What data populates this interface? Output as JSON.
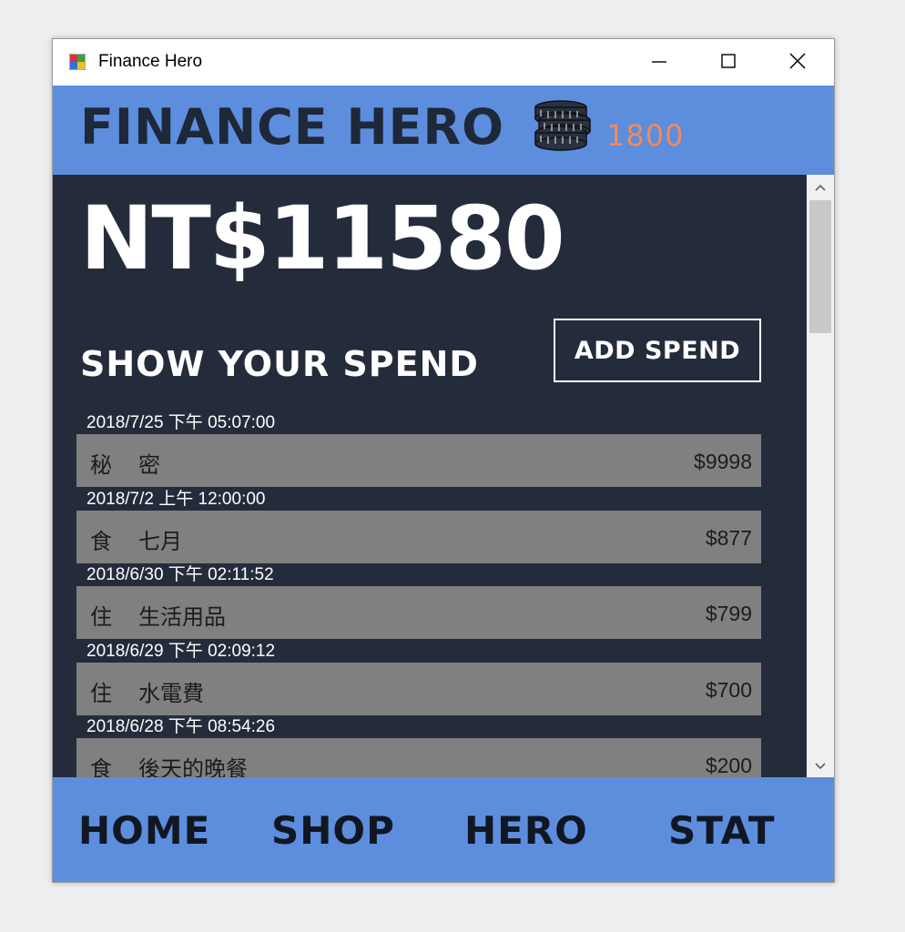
{
  "window": {
    "title": "Finance Hero"
  },
  "header": {
    "app_name": "FINANCE HERO",
    "coin_count": "1800",
    "brand_color": "#5d8ddd",
    "coin_color": "#f08a5a"
  },
  "main": {
    "balance": "NT$11580",
    "section_title": "SHOW YOUR SPEND",
    "add_button_label": "ADD SPEND",
    "spends": [
      {
        "date": "2018/7/25 下午 05:07:00",
        "category": "秘",
        "description": "密",
        "amount": "$9998"
      },
      {
        "date": "2018/7/2 上午 12:00:00",
        "category": "食",
        "description": "七月",
        "amount": "$877"
      },
      {
        "date": "2018/6/30 下午 02:11:52",
        "category": "住",
        "description": "生活用品",
        "amount": "$799"
      },
      {
        "date": "2018/6/29 下午 02:09:12",
        "category": "住",
        "description": "水電費",
        "amount": "$700"
      },
      {
        "date": "2018/6/28 下午 08:54:26",
        "category": "食",
        "description": "後天的晚餐",
        "amount": "$200"
      }
    ]
  },
  "nav": {
    "home": "HOME",
    "shop": "SHOP",
    "hero": "HERO",
    "stat": "STAT"
  },
  "icons": {
    "app": "app-window-icon",
    "coins": "coin-stack-icon",
    "minimize": "minimize-icon",
    "maximize": "maximize-icon",
    "close": "close-icon",
    "scroll_up": "chevron-up-icon",
    "scroll_down": "chevron-down-icon"
  }
}
